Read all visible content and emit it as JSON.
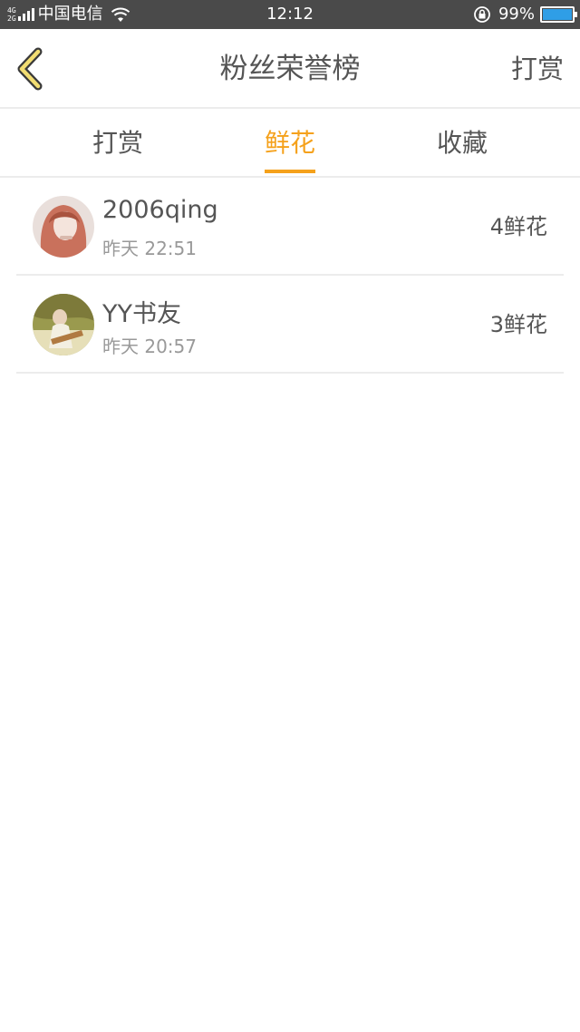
{
  "status_bar": {
    "network": "4G 2G",
    "carrier": "中国电信",
    "time": "12:12",
    "battery_percent": "99%",
    "battery_level": 0.99
  },
  "nav": {
    "title": "粉丝荣誉榜",
    "action_label": "打赏"
  },
  "tabs": [
    {
      "label": "打赏",
      "active": false
    },
    {
      "label": "鲜花",
      "active": true
    },
    {
      "label": "收藏",
      "active": false
    }
  ],
  "list": [
    {
      "name": "2006qing",
      "time": "昨天 22:51",
      "count": "4鲜花"
    },
    {
      "name": "YY书友",
      "time": "昨天 20:57",
      "count": "3鲜花"
    }
  ],
  "colors": {
    "accent": "#f5a11b",
    "text": "#555555",
    "subtext": "#999999",
    "divider": "#ececec",
    "status_bar_bg": "#4a4a4a"
  }
}
